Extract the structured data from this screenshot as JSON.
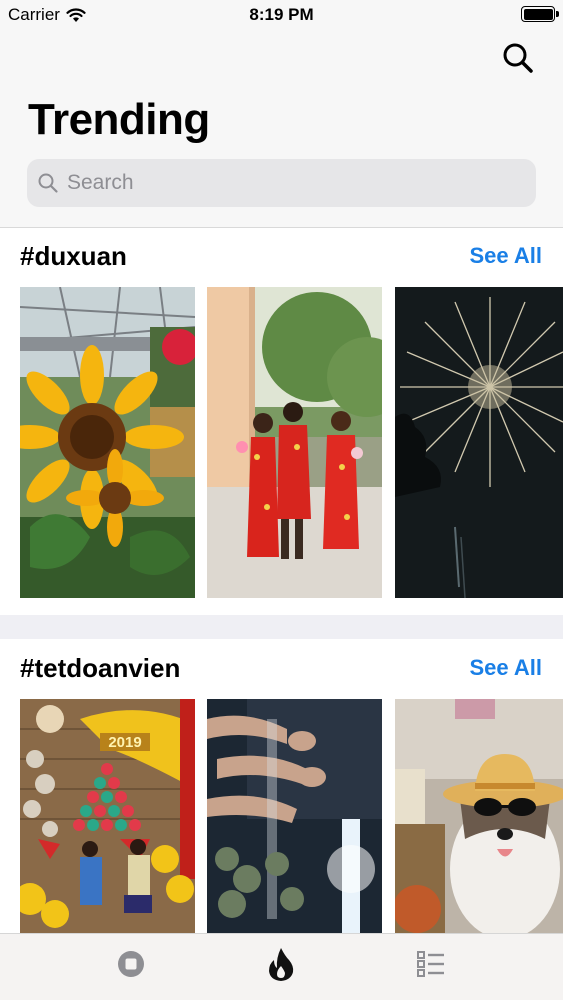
{
  "status_bar": {
    "carrier": "Carrier",
    "time": "8:19 PM",
    "icons": [
      "wifi-icon",
      "battery-icon"
    ]
  },
  "header": {
    "title": "Trending",
    "search_icon": "search-icon"
  },
  "search": {
    "placeholder": "Search",
    "value": ""
  },
  "sections": [
    {
      "title": "#duxuan",
      "see_all": "See All",
      "videos": [
        "sunflower video",
        "women in red ao dai video",
        "fireworks video"
      ]
    },
    {
      "title": "#tetdoanvien",
      "see_all": "See All",
      "videos": [
        "2019 tet decoration video",
        "hands reaching at night video",
        "husky in sunglasses and hat video"
      ]
    }
  ],
  "tab_bar": {
    "items": [
      "home-tab",
      "trending-tab",
      "list-tab"
    ],
    "selected": "trending-tab"
  },
  "colors": {
    "accent": "#1a7fe6",
    "header_bg": "#f7f7f7",
    "separator": "#efeff4"
  }
}
